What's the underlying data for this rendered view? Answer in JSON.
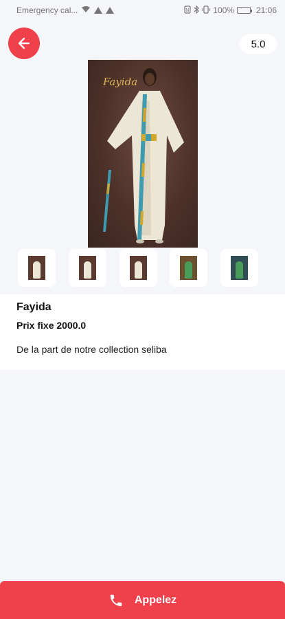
{
  "status_bar": {
    "carrier": "Emergency cal...",
    "battery": "100%",
    "time": "21:06",
    "icons": [
      "wifi-icon",
      "warning-icon",
      "warning-icon",
      "nfc-icon",
      "bluetooth-icon",
      "vibrate-icon",
      "battery-icon"
    ]
  },
  "header": {
    "back_icon": "arrow-left-icon",
    "rating": "5.0"
  },
  "product": {
    "brand_logo": "Fayida",
    "name": "Fayida",
    "price": "Prix fixe 2000.0",
    "description": "De la part de notre collection seliba",
    "thumbnail_count": 5
  },
  "call": {
    "label": "Appelez",
    "icon": "phone-icon"
  },
  "colors": {
    "accent": "#f0404a",
    "background": "#f5f6fa",
    "panel": "#ffffff"
  }
}
